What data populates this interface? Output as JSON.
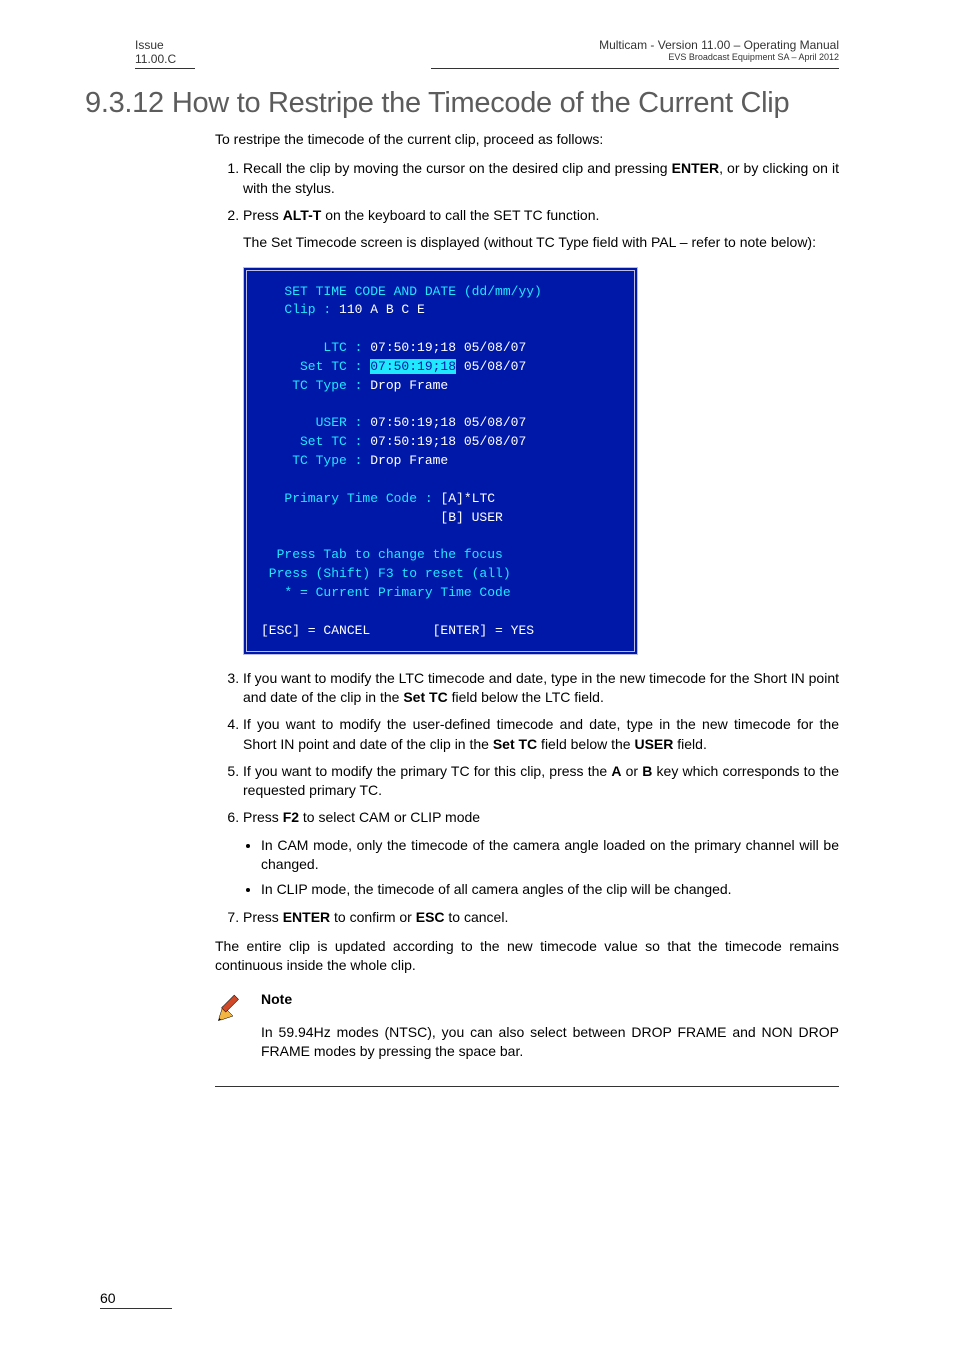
{
  "header": {
    "left_line1": "Issue",
    "left_line2": "11.00.C",
    "right_line1": "Multicam - Version 11.00 – Operating Manual",
    "right_line2": "EVS Broadcast Equipment SA – April 2012"
  },
  "section": {
    "number": "9.3.12",
    "title": "How to Restripe the Timecode of the Current Clip"
  },
  "intro": "To restripe the timecode of the current clip, proceed as follows:",
  "steps": {
    "s1a": "Recall the clip by moving the cursor on the desired clip and pressing ",
    "s1b": "ENTER",
    "s1c": ", or by clicking on it with the stylus.",
    "s2a": "Press ",
    "s2b": "ALT-T",
    "s2c": " on the keyboard to call the SET TC function.",
    "s2d": "The Set Timecode screen is displayed (without TC Type field with PAL – refer to note below):",
    "s3a": "If you want to modify the LTC timecode and date, type in the new timecode for the Short IN point and date of the clip in the ",
    "s3b": "Set TC",
    "s3c": " field below the LTC field.",
    "s4a": "If you want to modify the user-defined timecode and date, type in the new timecode for the Short IN point and date of the clip in the ",
    "s4b": "Set TC",
    "s4c": " field below the ",
    "s4d": "USER",
    "s4e": " field.",
    "s5a": "If you want to modify the primary TC for this clip, press the ",
    "s5b": "A",
    "s5c": " or ",
    "s5d": "B",
    "s5e": " key which corresponds to the requested primary TC.",
    "s6a": "Press ",
    "s6b": "F2",
    "s6c": " to select CAM or CLIP mode",
    "s6_bullet1": "In CAM mode, only the timecode of the camera angle loaded on the primary channel will be changed.",
    "s6_bullet2": "In CLIP mode, the timecode of all camera angles of the clip will be changed.",
    "s7a": "Press ",
    "s7b": "ENTER",
    "s7c": " to confirm or ",
    "s7d": "ESC",
    "s7e": " to cancel."
  },
  "closing": "The entire clip is updated according to the new timecode value so that the timecode remains continuous inside the whole clip.",
  "note": {
    "title": "Note",
    "body": "In 59.94Hz modes (NTSC), you can also select between DROP FRAME and NON DROP FRAME modes by pressing the space bar."
  },
  "terminal": {
    "l1": "   SET TIME CODE AND DATE (dd/mm/yy)",
    "l2a": "   Clip : ",
    "l2b": "110 A B C E",
    "l3": "",
    "l4a": "        LTC : ",
    "l4b": "07:50:19;18 05/08/07",
    "l5a": "     Set TC : ",
    "l5b": "07:50:19;18",
    "l5c": " 05/08/07",
    "l6a": "    TC Type : ",
    "l6b": "Drop Frame",
    "l7": "",
    "l8a": "       USER : ",
    "l8b": "07:50:19;18 05/08/07",
    "l9a": "     Set TC : ",
    "l9b": "07:50:19;18 05/08/07",
    "l10a": "    TC Type : ",
    "l10b": "Drop Frame",
    "l11": "",
    "l12a": "   Primary Time Code : ",
    "l12b": "[A]*LTC",
    "l13": "                       [B] USER",
    "l14": "",
    "l15": "  Press Tab to change the focus",
    "l16": " Press (Shift) F3 to reset (all)",
    "l17": "   * = Current Primary Time Code",
    "l18": "",
    "l19": "[ESC] = CANCEL        [ENTER] = YES"
  },
  "page_number": "60"
}
